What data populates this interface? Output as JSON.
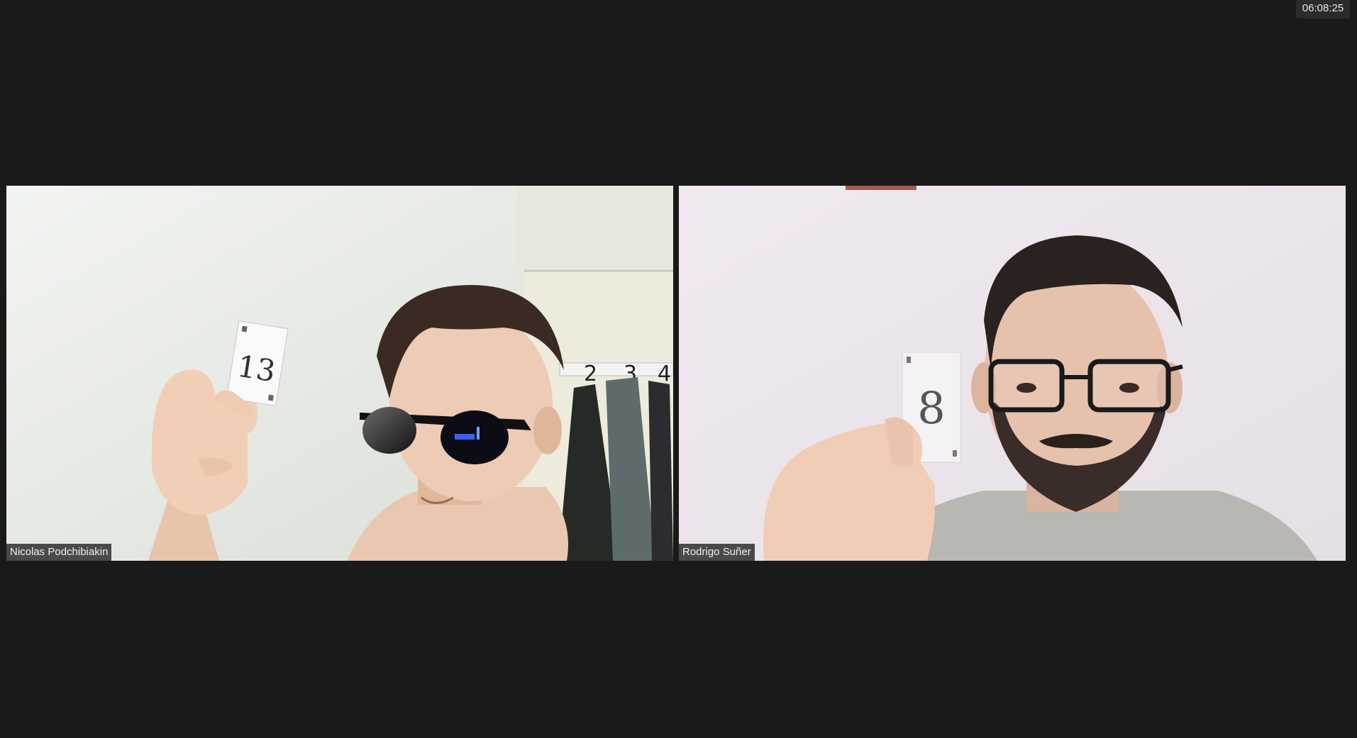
{
  "clock": {
    "time": "06:08:25"
  },
  "participants": [
    {
      "name": "Nicolas Podchibiakin",
      "card_number": "13",
      "card_icon": "playing-card-icon",
      "accessory": "sunglasses"
    },
    {
      "name": "Rodrigo Suñer",
      "card_number": "8",
      "card_icon": "playing-card-icon",
      "accessory": "glasses"
    }
  ],
  "background_hooks": [
    "2",
    "3",
    "4"
  ],
  "colors": {
    "background": "#1a1a1a",
    "name_tag_bg": "#1e1e1e",
    "name_tag_text": "#f0f0f0"
  }
}
